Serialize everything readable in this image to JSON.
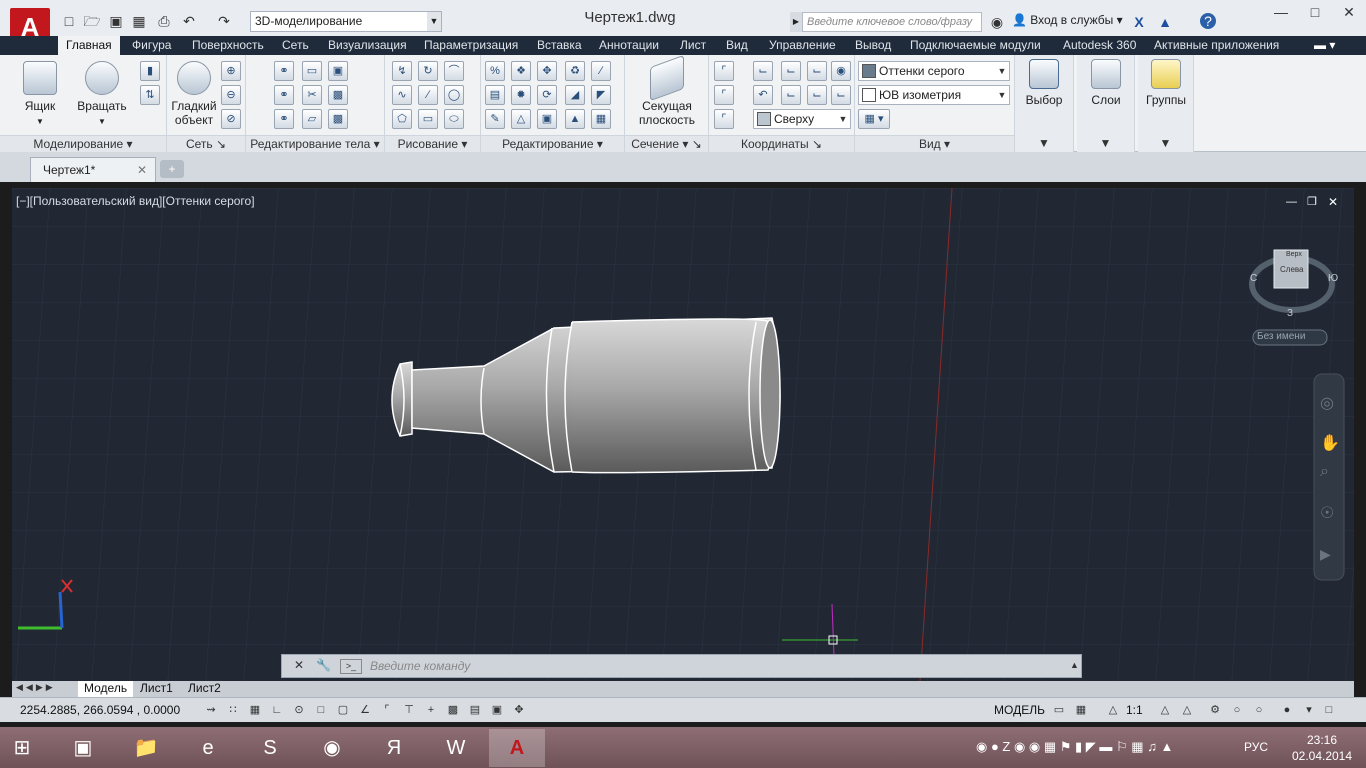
{
  "app": {
    "logo": "A",
    "workspace": "3D-моделирование",
    "doc_title": "Чертеж1.dwg",
    "search_placeholder": "Введите ключевое слово/фразу",
    "login": "Вход в службы"
  },
  "ribbon_tabs": [
    "Главная",
    "Фигура",
    "Поверхность",
    "Сеть",
    "Визуализация",
    "Параметризация",
    "Вставка",
    "Аннотации",
    "Лист",
    "Вид",
    "Управление",
    "Вывод",
    "Подключаемые модули",
    "Autodesk 360",
    "Активные приложения"
  ],
  "panels": {
    "modeling": "Моделирование",
    "mesh": "Сеть",
    "solid_edit": "Редактирование тела",
    "draw": "Рисование",
    "modify": "Редактирование",
    "section": "Сечение",
    "coords": "Координаты",
    "view": "Вид"
  },
  "buttons": {
    "box": "Ящик",
    "revolve": "Вращать",
    "smooth_l1": "Гладкий",
    "smooth_l2": "объект",
    "sect_l1": "Секущая",
    "sect_l2": "плоскость",
    "select": "Выбор",
    "layers": "Слои",
    "groups": "Группы"
  },
  "combos": {
    "visual_style": "Оттенки серого",
    "view_dir": "ЮВ изометрия",
    "ucs": "Сверху"
  },
  "file_tab": "Чертеж1*",
  "viewport": {
    "label": "[−][Пользовательский вид][Оттенки серого]",
    "viewcube_face": "Слева",
    "viewcube_top": "Верх",
    "compass_n": "С",
    "compass_s": "З",
    "compass_e": "Ю",
    "ucs_name": "Без имени"
  },
  "command": {
    "placeholder": "Введите команду"
  },
  "layout_tabs": [
    "Модель",
    "Лист1",
    "Лист2"
  ],
  "status": {
    "coords": "2254.2885, 266.0594  , 0.0000",
    "model": "МОДЕЛЬ",
    "scale": "1:1"
  },
  "taskbar": {
    "lang": "РУС",
    "time": "23:16",
    "date": "02.04.2014"
  }
}
